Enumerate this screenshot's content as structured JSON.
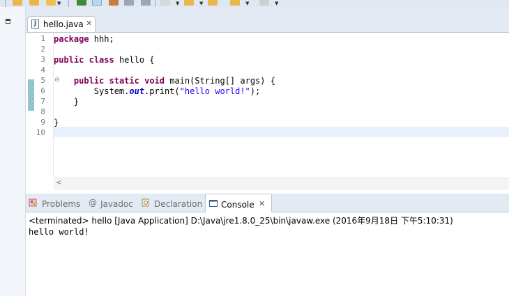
{
  "editor": {
    "tab": {
      "label": "hello.java",
      "file_icon": "J",
      "close_glyph": "✕"
    },
    "lines": [
      {
        "number": "1",
        "tokens": [
          {
            "t": "package",
            "c": "kw"
          },
          {
            "t": " hhh;",
            "c": ""
          }
        ]
      },
      {
        "number": "2",
        "tokens": []
      },
      {
        "number": "3",
        "tokens": [
          {
            "t": "public",
            "c": "kw"
          },
          {
            "t": " ",
            "c": ""
          },
          {
            "t": "class",
            "c": "kw"
          },
          {
            "t": " hello {",
            "c": ""
          }
        ]
      },
      {
        "number": "4",
        "tokens": []
      },
      {
        "number": "5",
        "tokens": [
          {
            "t": "    ",
            "c": ""
          },
          {
            "t": "public",
            "c": "kw"
          },
          {
            "t": " ",
            "c": ""
          },
          {
            "t": "static",
            "c": "kw"
          },
          {
            "t": " ",
            "c": ""
          },
          {
            "t": "void",
            "c": "kw"
          },
          {
            "t": " main(String[] args) {",
            "c": ""
          }
        ]
      },
      {
        "number": "6",
        "tokens": [
          {
            "t": "        System.",
            "c": ""
          },
          {
            "t": "out",
            "c": "fld"
          },
          {
            "t": ".print(",
            "c": ""
          },
          {
            "t": "\"hello world!\"",
            "c": "str"
          },
          {
            "t": ");",
            "c": ""
          }
        ]
      },
      {
        "number": "7",
        "tokens": [
          {
            "t": "    }",
            "c": ""
          }
        ]
      },
      {
        "number": "8",
        "tokens": []
      },
      {
        "number": "9",
        "tokens": [
          {
            "t": "}",
            "c": ""
          }
        ]
      },
      {
        "number": "10",
        "tokens": []
      }
    ],
    "fold_glyph": "⊖",
    "scroll_left_glyph": "<"
  },
  "console_view": {
    "tabs": [
      {
        "label": "Problems",
        "icon": "problems-icon"
      },
      {
        "label": "Javadoc",
        "icon": "javadoc-icon"
      },
      {
        "label": "Declaration",
        "icon": "declaration-icon"
      },
      {
        "label": "Console",
        "icon": "console-icon",
        "active": true
      }
    ],
    "close_glyph": "✕",
    "javadoc_glyph": "@",
    "description": "<terminated> hello [Java Application] D:\\Java\\jre1.8.0_25\\bin\\javaw.exe (2016年9月18日 下午5:10:31)",
    "output": "hello world!"
  },
  "colors": {
    "keyword": "#7f0055",
    "string": "#2a00ff",
    "static_field": "#0000c0",
    "current_line": "#e8f2fe",
    "chrome": "#e3eaf3"
  }
}
